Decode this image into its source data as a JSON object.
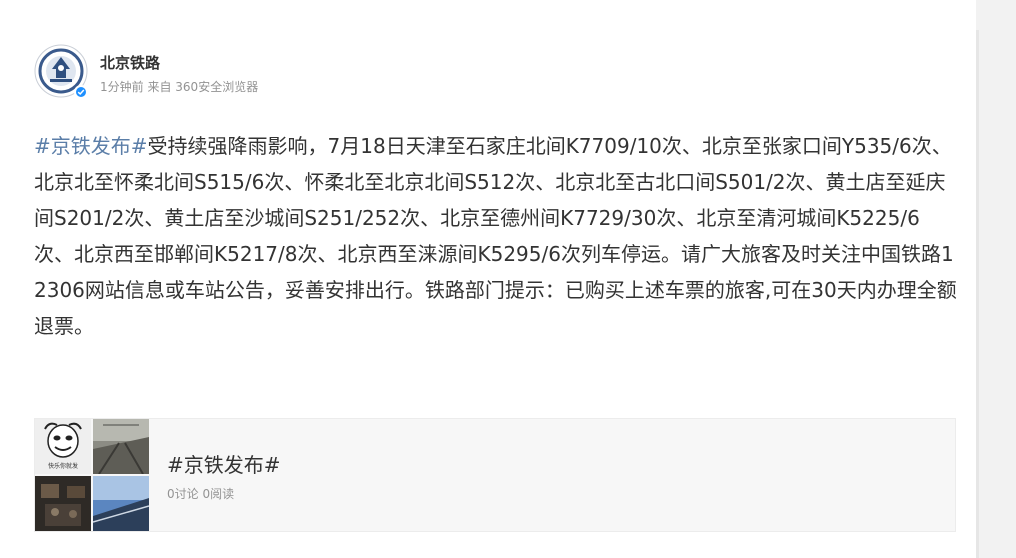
{
  "author": {
    "name": "北京铁路",
    "time": "1分钟前",
    "source": "来自 360安全浏览器",
    "avatar_icon": "china-railway-emblem-icon",
    "verified_icon": "verified-badge-icon",
    "verified_color": "#1e90ff"
  },
  "post": {
    "hashtag": "#京铁发布#",
    "body": "受持续强降雨影响，7月18日天津至石家庄北间K7709/10次、北京至张家口间Y535/6次、北京北至怀柔北间S515/6次、怀柔北至北京北间S512次、北京北至古北口间S501/2次、黄土店至延庆间S201/2次、黄土店至沙城间S251/252次、北京至德州间K7729/30次、北京至清河城间K5225/6次、北京西至邯郸间K5217/8次、北京西至涞源间K5295/6次列车停运。请广大旅客及时关注中国铁路12306网站信息或车站公告，妥善安排出行。铁路部门提示：已购买上述车票的旅客,可在30天内办理全额退票。",
    "hashtag_color": "#5b7ea8",
    "text_color": "#333333"
  },
  "topic_card": {
    "title": "#京铁发布#",
    "stats": "0讨论 0阅读",
    "thumb_caption": "快乐你就发"
  }
}
